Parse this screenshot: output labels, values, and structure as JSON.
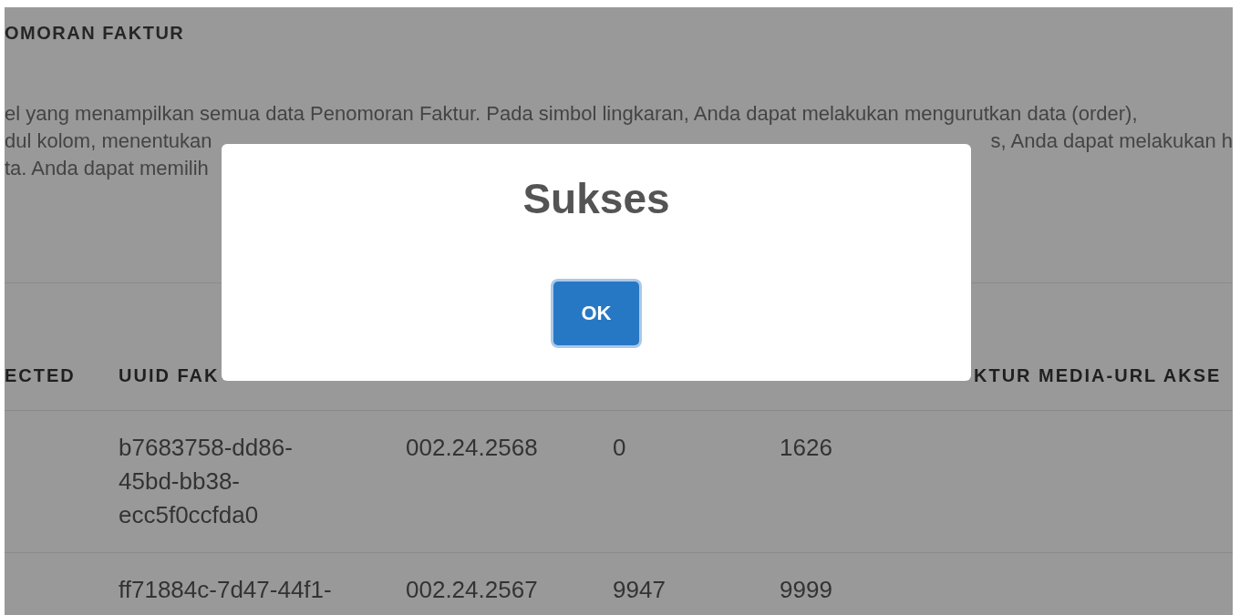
{
  "page": {
    "title": "OMORAN FAKTUR",
    "description_lines": [
      {
        "left": "el yang menampilkan semua data Penomoran Faktur. Pada simbol lingkaran, Anda dapat melakukan mengurutkan data (order),"
      },
      {
        "left": "dul kolom, menentukan",
        "right": "s, Anda dapat melakukan h"
      },
      {
        "left": "ta. Anda dapat memilih"
      }
    ]
  },
  "table": {
    "columns": [
      "ECTED",
      "UUID FAK",
      "",
      "",
      "",
      "KTUR MEDIA-URL AKSE"
    ],
    "rows": [
      [
        "",
        "b7683758-dd86-45bd-bb38-ecc5f0ccfda0",
        "002.24.2568",
        "0",
        "1626",
        ""
      ],
      [
        "",
        "ff71884c-7d47-44f1-",
        "002.24.2567",
        "9947",
        "9999",
        ""
      ]
    ]
  },
  "dialog": {
    "title": "Sukses",
    "buttons": [
      {
        "label": "OK",
        "focused": true
      }
    ]
  }
}
